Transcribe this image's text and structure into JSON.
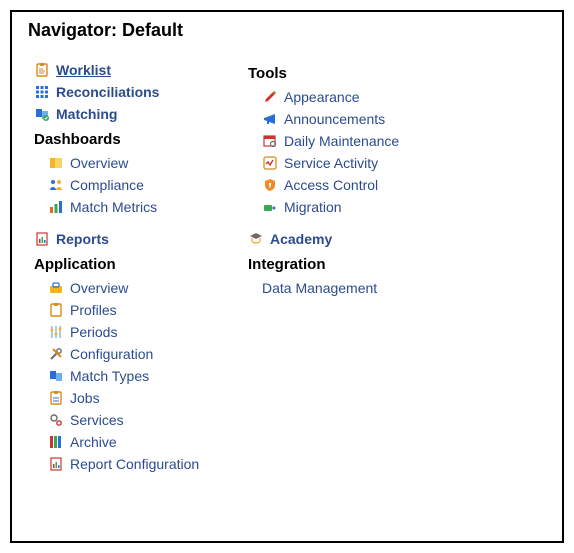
{
  "title": "Navigator: Default",
  "left": {
    "top_links": [
      {
        "label": "Worklist",
        "bold": true,
        "underline": true
      },
      {
        "label": "Reconciliations",
        "bold": true,
        "underline": false
      },
      {
        "label": "Matching",
        "bold": true,
        "underline": false
      }
    ],
    "dashboards": {
      "header": "Dashboards",
      "items": [
        {
          "label": "Overview"
        },
        {
          "label": "Compliance"
        },
        {
          "label": "Match Metrics"
        }
      ]
    },
    "reports_link": {
      "label": "Reports",
      "bold": true
    },
    "application": {
      "header": "Application",
      "items": [
        {
          "label": "Overview"
        },
        {
          "label": "Profiles"
        },
        {
          "label": "Periods"
        },
        {
          "label": "Configuration"
        },
        {
          "label": "Match Types"
        },
        {
          "label": "Jobs"
        },
        {
          "label": "Services"
        },
        {
          "label": "Archive"
        },
        {
          "label": "Report Configuration"
        }
      ]
    }
  },
  "right": {
    "tools": {
      "header": "Tools",
      "items": [
        {
          "label": "Appearance"
        },
        {
          "label": "Announcements"
        },
        {
          "label": "Daily Maintenance"
        },
        {
          "label": "Service Activity"
        },
        {
          "label": "Access Control"
        },
        {
          "label": "Migration"
        }
      ]
    },
    "academy_link": {
      "label": "Academy",
      "bold": true
    },
    "integration": {
      "header": "Integration",
      "items": [
        {
          "label": "Data Management"
        }
      ]
    }
  }
}
